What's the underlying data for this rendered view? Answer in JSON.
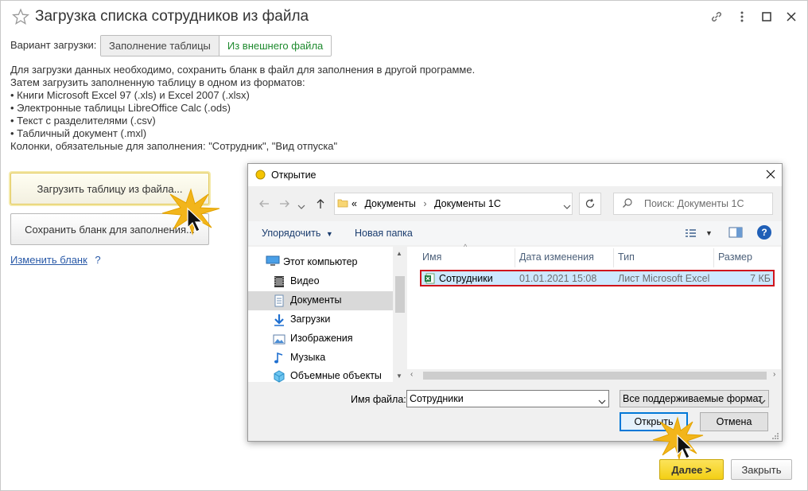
{
  "window": {
    "title": "Загрузка списка сотрудников из файла",
    "link_icon": "link-icon",
    "more_icon": "more-icon",
    "maximize_icon": "maximize-icon",
    "close_icon": "close-icon"
  },
  "load_variant": {
    "label": "Вариант загрузки:",
    "options": [
      "Заполнение таблицы",
      "Из внешнего файла"
    ],
    "selected": "Из внешнего файла"
  },
  "info_lines": [
    "Для загрузки данных необходимо, сохранить бланк в файл для заполнения в другой программе.",
    "Затем загрузить заполненную таблицу в одном из форматов:",
    "• Книги Microsoft Excel 97 (.xls) и Excel 2007 (.xlsx)",
    "• Электронные таблицы LibreOffice Calc (.ods)",
    "• Текст с разделителями (.csv)",
    "• Табличный документ (.mxl)",
    "Колонки, обязательные для заполнения: \"Сотрудник\", \"Вид отпуска\""
  ],
  "buttons": {
    "load_table": "Загрузить таблицу из файла...",
    "save_blank": "Сохранить бланк для заполнения...",
    "change_blank": "Изменить бланк",
    "help": "?",
    "next": "Далее >",
    "close": "Закрыть"
  },
  "dialog": {
    "title": "Открытие",
    "breadcrumb": [
      "«",
      "Документы",
      "Документы 1С"
    ],
    "search_placeholder": "Поиск: Документы 1С",
    "toolbar": {
      "organize": "Упорядочить",
      "new_folder": "Новая папка",
      "help": "?"
    },
    "nav_items": [
      {
        "label": "Этот компьютер",
        "icon": "computer-icon"
      },
      {
        "label": "Видео",
        "icon": "video-icon"
      },
      {
        "label": "Документы",
        "icon": "documents-icon"
      },
      {
        "label": "Загрузки",
        "icon": "downloads-icon"
      },
      {
        "label": "Изображения",
        "icon": "images-icon"
      },
      {
        "label": "Музыка",
        "icon": "music-icon"
      },
      {
        "label": "Объемные объекты",
        "icon": "3d-objects-icon"
      }
    ],
    "nav_selected": "Документы",
    "columns": [
      "Имя",
      "Дата изменения",
      "Тип",
      "Размер"
    ],
    "files": [
      {
        "name": "Сотрудники",
        "date": "01.01.2021 15:08",
        "type": "Лист Microsoft Excel",
        "size": "7 КБ"
      }
    ],
    "filename_label": "Имя файла:",
    "filename_value": "Сотрудники",
    "filetype_value": "Все поддерживаемые формат",
    "open_button": "Открыть",
    "cancel_button": "Отмена"
  },
  "colors": {
    "accent_green": "#1e8a2e",
    "link_blue": "#2a5aa8",
    "next_yellow": "#f3cf15",
    "selection_border": "#d0141c",
    "selection_fill": "#cde8ff"
  }
}
